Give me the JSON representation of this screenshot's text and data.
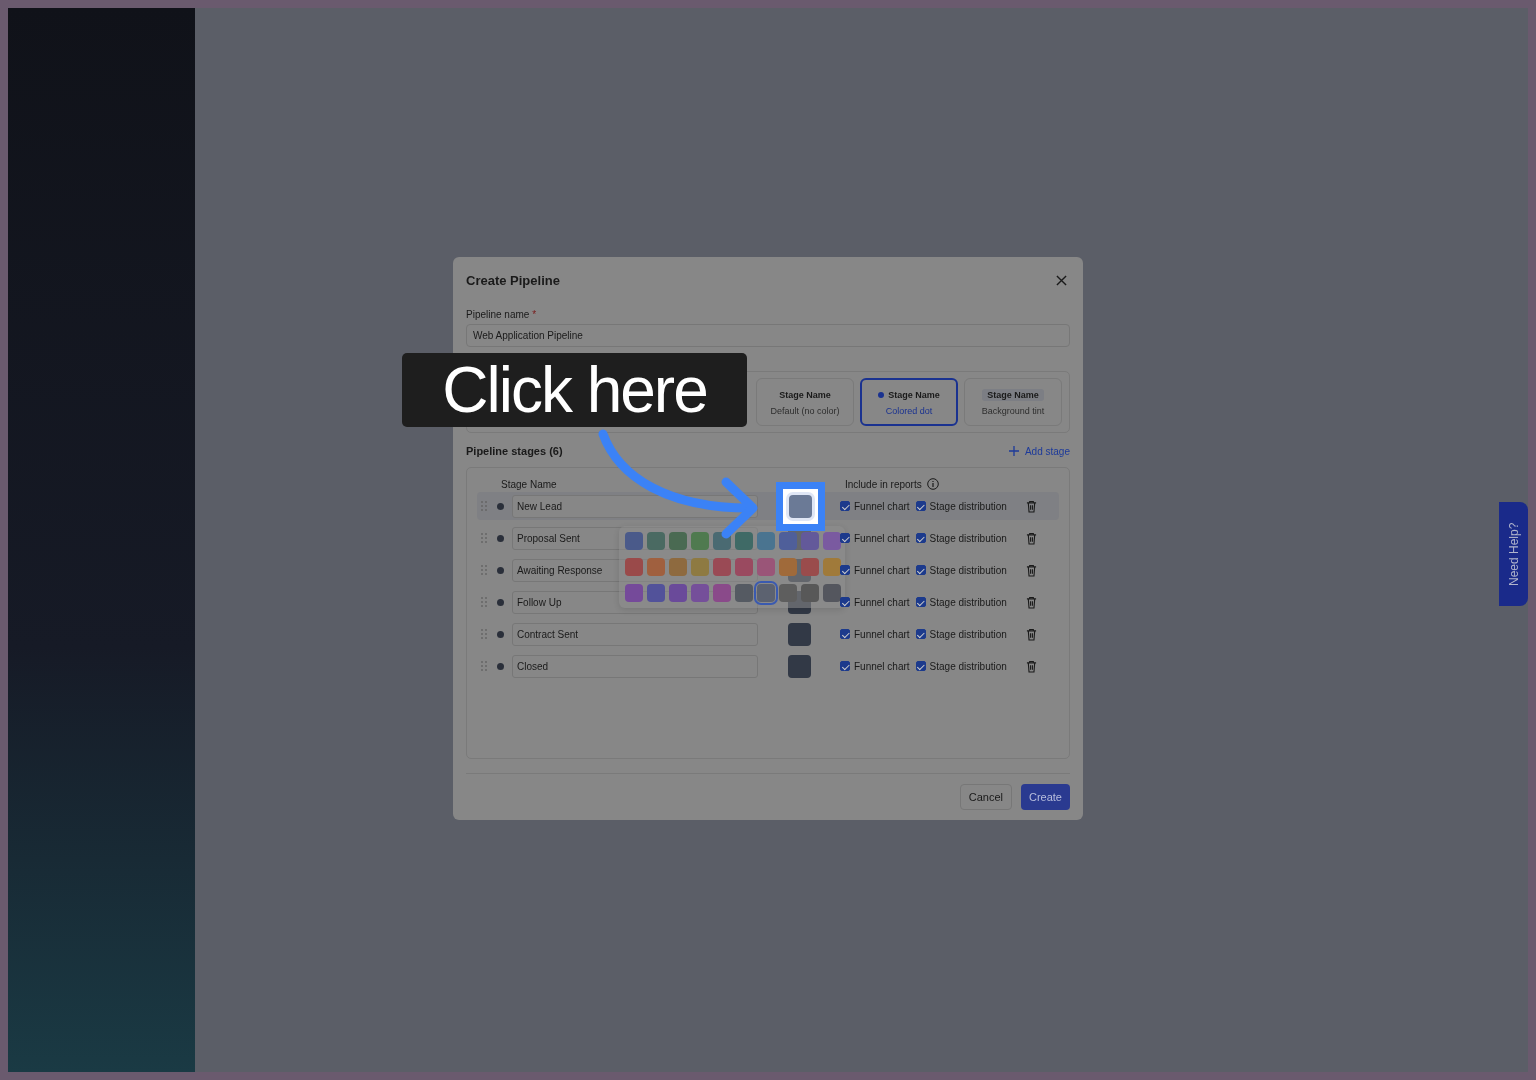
{
  "modal": {
    "title": "Create Pipeline",
    "pipeline_name": {
      "label": "Pipeline name",
      "required_mark": "*",
      "value": "Web Application Pipeline"
    },
    "display_options": [
      {
        "label": "Stage Name",
        "caption": "Default (no color)",
        "kind": "plain",
        "selected": false
      },
      {
        "label": "Stage Name",
        "caption": "Colored dot",
        "kind": "dot",
        "selected": true
      },
      {
        "label": "Stage Name",
        "caption": "Background tint",
        "kind": "tint",
        "selected": false
      }
    ],
    "stages_title": "Pipeline stages (6)",
    "add_stage": "Add stage",
    "columns": {
      "name": "Stage Name",
      "reports": "Include in reports"
    },
    "stages": [
      {
        "name": "New Lead",
        "highlighted": true,
        "funnel_label": "Funnel chart",
        "funnel_checked": true,
        "distribution_label": "Stage distribution",
        "distribution_checked": true
      },
      {
        "name": "Proposal Sent",
        "highlighted": false,
        "funnel_label": "Funnel chart",
        "funnel_checked": true,
        "distribution_label": "Stage distribution",
        "distribution_checked": true
      },
      {
        "name": "Awaiting Response",
        "highlighted": false,
        "funnel_label": "Funnel chart",
        "funnel_checked": true,
        "distribution_label": "Stage distribution",
        "distribution_checked": true
      },
      {
        "name": "Follow Up",
        "highlighted": false,
        "funnel_label": "Funnel chart",
        "funnel_checked": true,
        "distribution_label": "Stage distribution",
        "distribution_checked": true
      },
      {
        "name": "Contract Sent",
        "highlighted": false,
        "funnel_label": "Funnel chart",
        "funnel_checked": true,
        "distribution_label": "Stage distribution",
        "distribution_checked": true
      },
      {
        "name": "Closed",
        "highlighted": false,
        "funnel_label": "Funnel chart",
        "funnel_checked": true,
        "distribution_label": "Stage distribution",
        "distribution_checked": true
      }
    ],
    "color_picker": {
      "swatches": [
        {
          "color": "#4a5a8a",
          "selected": false
        },
        {
          "color": "#4a6a62",
          "selected": false
        },
        {
          "color": "#4a6a52",
          "selected": false
        },
        {
          "color": "#4f7a4f",
          "selected": false
        },
        {
          "color": "#4a6a72",
          "selected": false
        },
        {
          "color": "#3f6a66",
          "selected": false
        },
        {
          "color": "#4a7490",
          "selected": false
        },
        {
          "color": "#4f5f9a",
          "selected": false
        },
        {
          "color": "#63599a",
          "selected": false
        },
        {
          "color": "#7a5aa0",
          "selected": false
        },
        {
          "color": "#9a4a4a",
          "selected": false
        },
        {
          "color": "#a0603f",
          "selected": false
        },
        {
          "color": "#8e6a3f",
          "selected": false
        },
        {
          "color": "#8e7a42",
          "selected": false
        },
        {
          "color": "#9a4a55",
          "selected": false
        },
        {
          "color": "#9a4a60",
          "selected": false
        },
        {
          "color": "#9a5578",
          "selected": false
        },
        {
          "color": "#a06a3a",
          "selected": false
        },
        {
          "color": "#9a4c4c",
          "selected": false
        },
        {
          "color": "#a07a3a",
          "selected": false
        },
        {
          "color": "#754a9a",
          "selected": false
        },
        {
          "color": "#52529a",
          "selected": false
        },
        {
          "color": "#6a4a9a",
          "selected": false
        },
        {
          "color": "#754f9a",
          "selected": false
        },
        {
          "color": "#8a4a8a",
          "selected": false
        },
        {
          "color": "#555a62",
          "selected": false
        },
        {
          "color": "#5c6270",
          "selected": true
        },
        {
          "color": "#5e5e5e",
          "selected": false
        },
        {
          "color": "#585858",
          "selected": false
        },
        {
          "color": "#54565e",
          "selected": false
        }
      ]
    },
    "buttons": {
      "cancel": "Cancel",
      "create": "Create"
    }
  },
  "callout": {
    "text": "Click here"
  },
  "help_tab": {
    "label": "Need Help?"
  }
}
